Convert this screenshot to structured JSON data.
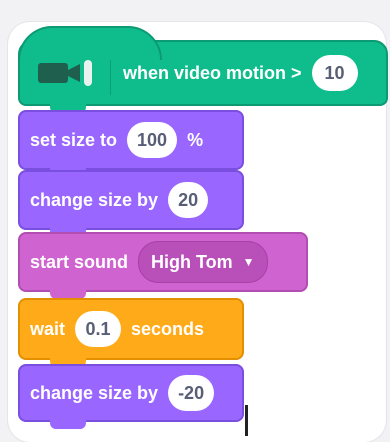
{
  "blocks": {
    "hat": {
      "label": "when video motion >",
      "value": "10",
      "icon": "video-camera-icon"
    },
    "set_size": {
      "label": "set size to",
      "value": "100",
      "suffix": "%"
    },
    "change_size_1": {
      "label": "change size by",
      "value": "20"
    },
    "start_sound": {
      "label": "start sound",
      "value": "High Tom"
    },
    "wait": {
      "label": "wait",
      "value": "0.1",
      "suffix": "seconds"
    },
    "change_size_2": {
      "label": "change size by",
      "value": "-20"
    }
  },
  "colors": {
    "hat": "#0fbd8c",
    "motion": "#9966ff",
    "sound": "#cf63cf",
    "control": "#ffab19"
  }
}
